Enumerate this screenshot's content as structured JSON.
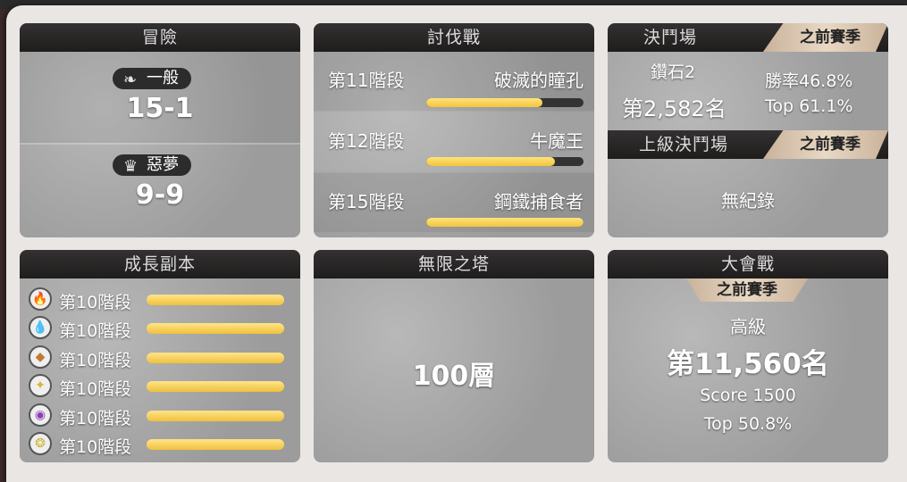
{
  "adventure": {
    "title": "冒險",
    "normal_label": "一般",
    "normal_score": "15-1",
    "nightmare_label": "惡夢",
    "nightmare_score": "9-9"
  },
  "raid": {
    "title": "討伐戰",
    "rows": [
      {
        "stage": "第11階段",
        "boss": "破滅的瞳孔",
        "progress": 0.74
      },
      {
        "stage": "第12階段",
        "boss": "牛魔王",
        "progress": 0.82
      },
      {
        "stage": "第15階段",
        "boss": "鋼鐵捕食者",
        "progress": 1.0
      }
    ]
  },
  "arena": {
    "title": "決鬥場",
    "season_tag": "之前賽季",
    "tier": "鑽石2",
    "rank": "第2,582名",
    "winrate": "勝率46.8%",
    "top": "Top 61.1%",
    "grand_title": "上級決鬥場",
    "grand_season_tag": "之前賽季",
    "grand_record": "無紀錄"
  },
  "growth": {
    "title": "成長副本",
    "rows": [
      {
        "icon": "fire-element-icon",
        "label": "第10階段",
        "color": "#d9534f",
        "glyph": "🔥"
      },
      {
        "icon": "water-element-icon",
        "label": "第10階段",
        "color": "#3b6fd1",
        "glyph": "💧"
      },
      {
        "icon": "earth-element-icon",
        "label": "第10階段",
        "color": "#c07a35",
        "glyph": "◆"
      },
      {
        "icon": "light-element-icon",
        "label": "第10階段",
        "color": "#d6b437",
        "glyph": "✦"
      },
      {
        "icon": "dark-element-icon",
        "label": "第10階段",
        "color": "#8b3fb3",
        "glyph": "◉"
      },
      {
        "icon": "wind-element-icon",
        "label": "第10階段",
        "color": "#d5b43a",
        "glyph": "❂"
      }
    ]
  },
  "tower": {
    "title": "無限之塔",
    "floor": "100層"
  },
  "tournament": {
    "title": "大會戰",
    "season_tag": "之前賽季",
    "tier": "高級",
    "rank": "第11,560名",
    "score": "Score 1500",
    "top": "Top 50.8%"
  }
}
